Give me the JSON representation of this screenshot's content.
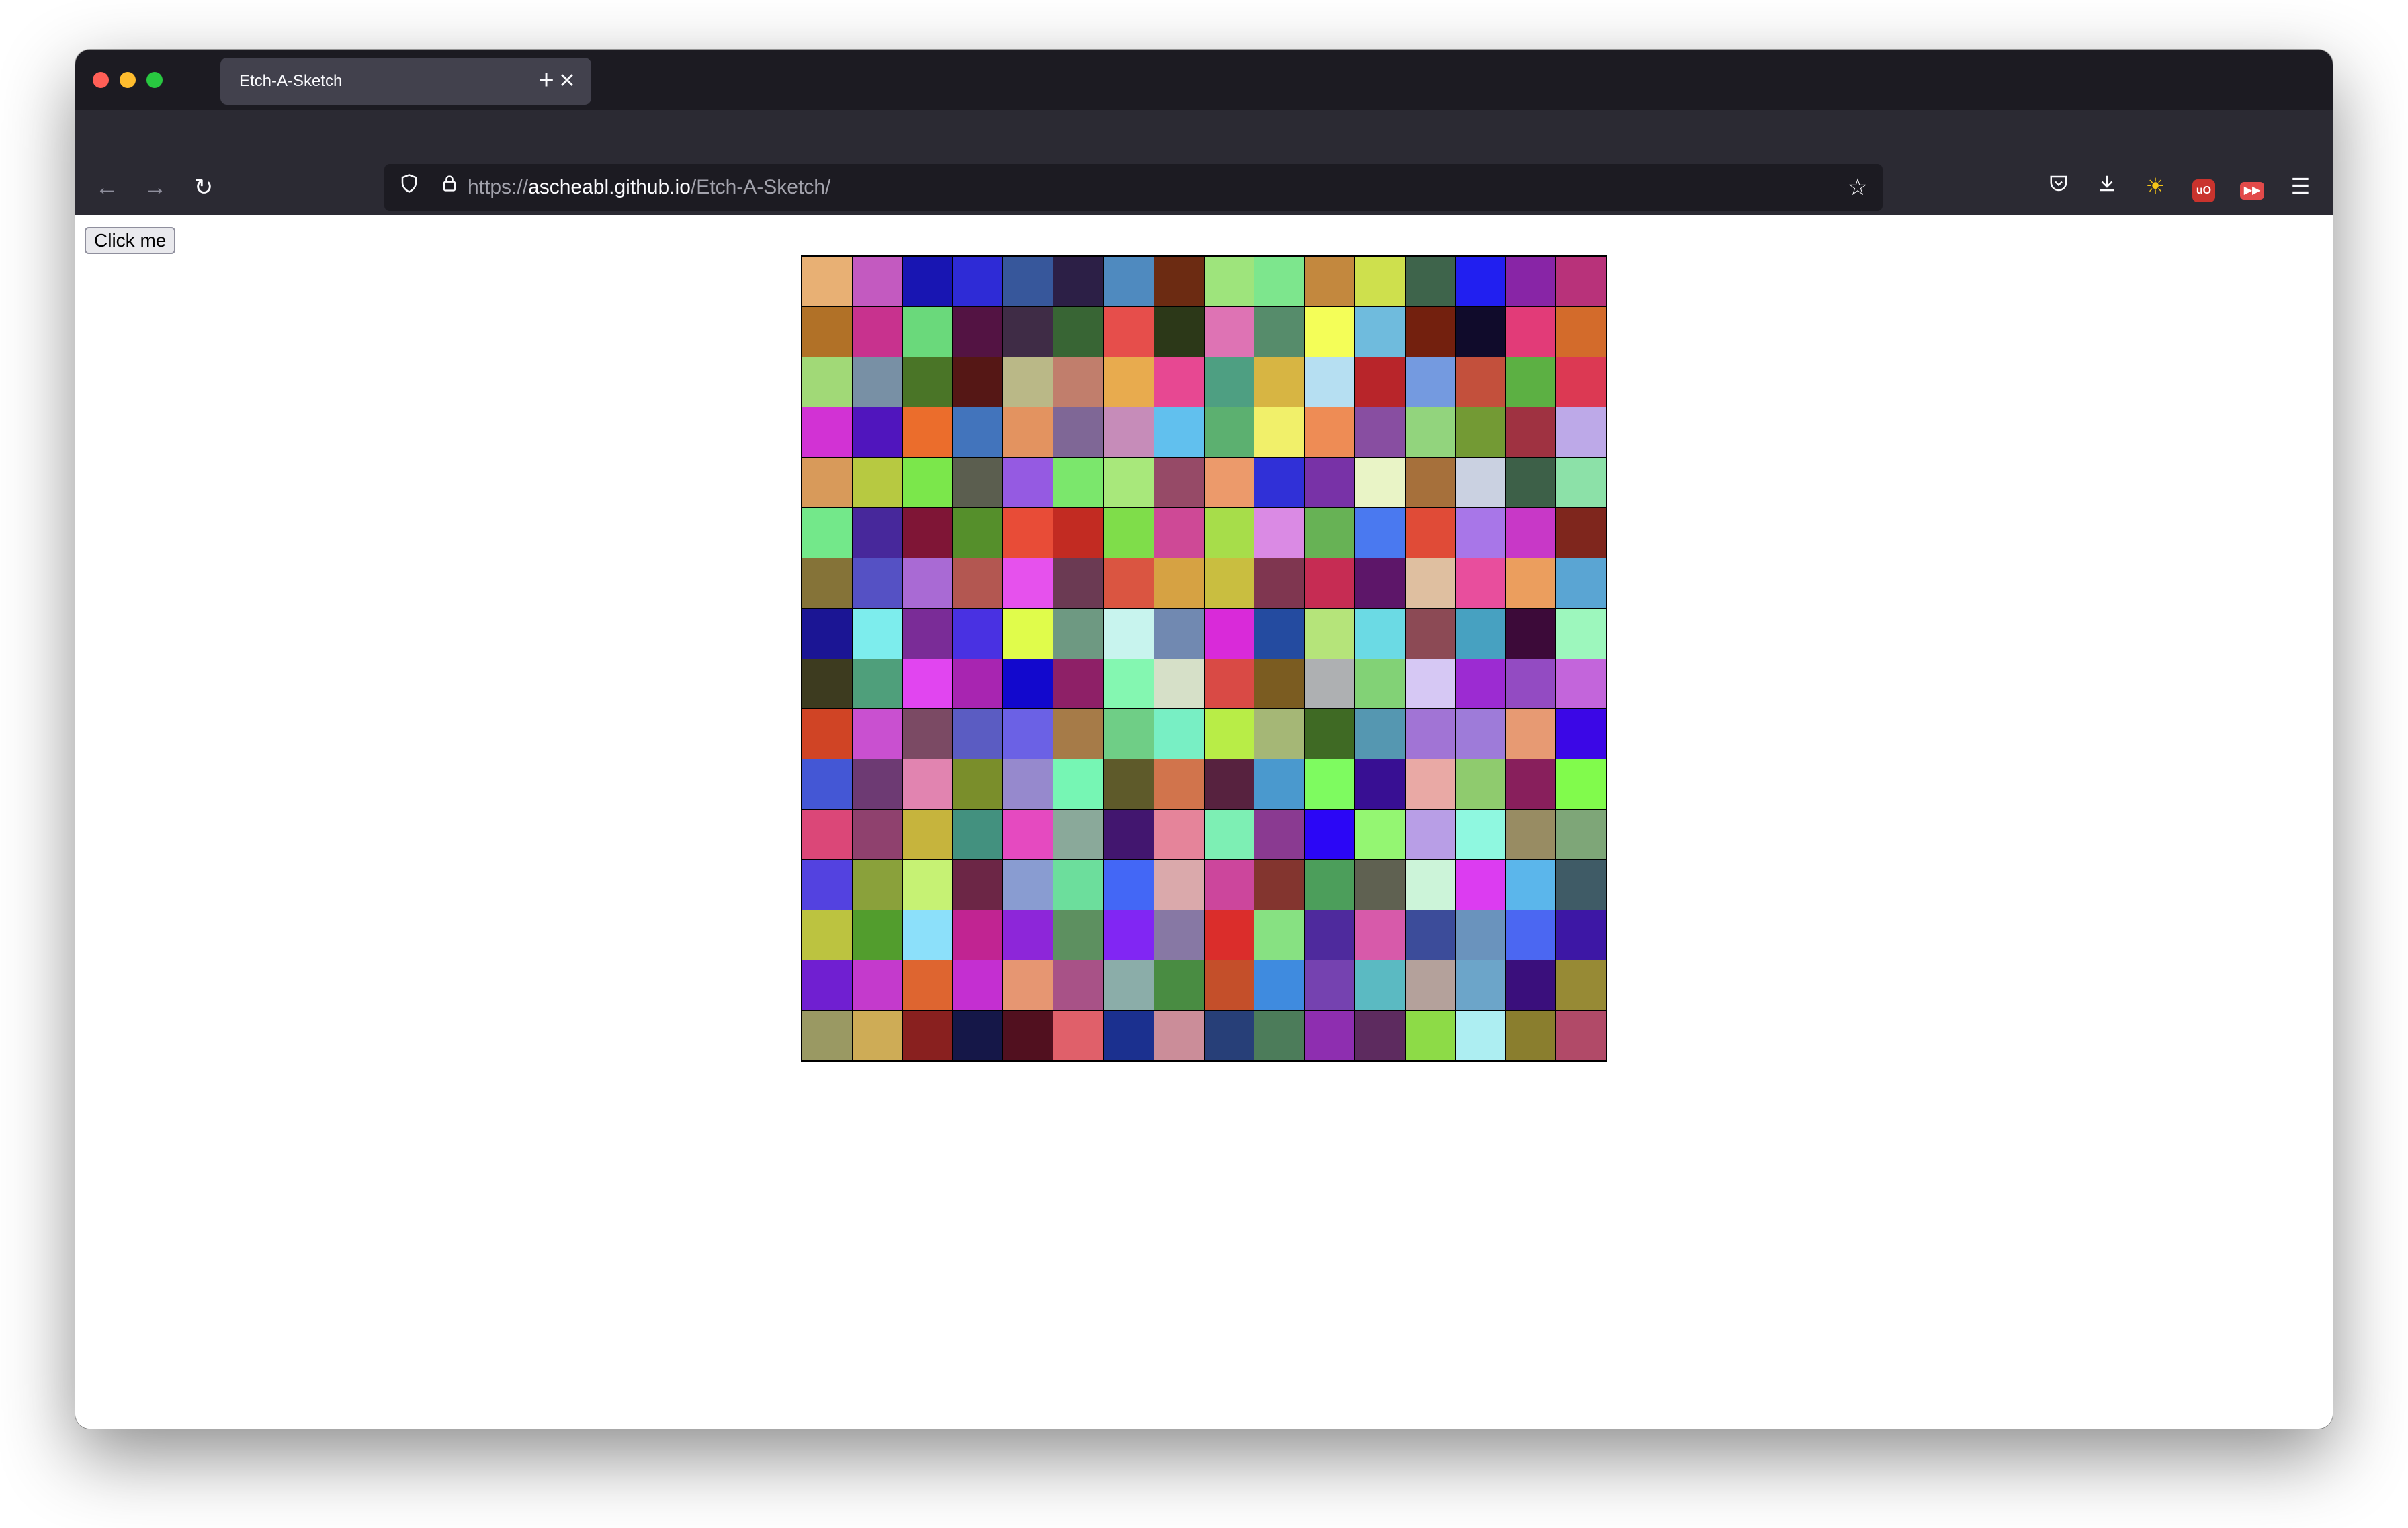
{
  "browser": {
    "tab": {
      "title": "Etch-A-Sketch",
      "close_icon": "close-icon"
    },
    "newtab_icon": "plus-icon",
    "url": {
      "scheme": "https://",
      "domain": "ascheabl.github.io",
      "path": "/Etch-A-Sketch/"
    },
    "toolbar_icons": [
      "pocket-icon",
      "download-icon",
      "sun-icon",
      "ublock-icon",
      "youtube-ext-icon",
      "menu-icon"
    ]
  },
  "page": {
    "button_label": "Click me",
    "grid": {
      "size": 16,
      "colors": [
        [
          "#e8b074",
          "#c35ac0",
          "#1815b2",
          "#2e2bd6",
          "#37579b",
          "#2c1f46",
          "#4f8abf",
          "#6c2b12",
          "#9ee47c",
          "#7de68d",
          "#c3883e",
          "#cee04d",
          "#3e644b",
          "#211ff0",
          "#8825a6",
          "#b8327a"
        ],
        [
          "#b17127",
          "#c8328e",
          "#6ad97b",
          "#531343",
          "#3f2c46",
          "#386534",
          "#e64e4b",
          "#2c3818",
          "#de73b4",
          "#568c6b",
          "#f4fe58",
          "#6fbbdd",
          "#73200e",
          "#100b2b",
          "#e23b78",
          "#d36b2b"
        ],
        [
          "#a1d977",
          "#7890a5",
          "#4a7527",
          "#551715",
          "#bab887",
          "#c17e6c",
          "#e8ab4e",
          "#e74892",
          "#4e9f82",
          "#d7b543",
          "#b6dff2",
          "#b8252a",
          "#749ae0",
          "#c3503c",
          "#5cb043",
          "#dc3953"
        ],
        [
          "#d232d4",
          "#5015bd",
          "#eb6d2c",
          "#4274bc",
          "#e39360",
          "#7f6796",
          "#c68cb9",
          "#61c0ee",
          "#5cb070",
          "#f1f06a",
          "#ee8c55",
          "#884ea1",
          "#92d47d",
          "#739a34",
          "#9f3241",
          "#bda9e8"
        ],
        [
          "#d89a5a",
          "#b7c941",
          "#7be74b",
          "#5b5e4f",
          "#955ae2",
          "#7be76c",
          "#a8e87b",
          "#964a67",
          "#ec9a6b",
          "#3030d7",
          "#7832a7",
          "#e9f4c6",
          "#a6703b",
          "#cad1e1",
          "#3d6048",
          "#8ce1a8"
        ],
        [
          "#73e88a",
          "#47289b",
          "#7f1536",
          "#558f2b",
          "#e84c37",
          "#c22b22",
          "#7fdd4a",
          "#ce4996",
          "#a7dd4a",
          "#da8ae4",
          "#67b255",
          "#4a79f0",
          "#e04b37",
          "#a876e8",
          "#c838c7",
          "#7f261d"
        ],
        [
          "#857338",
          "#5551c4",
          "#a96ad4",
          "#b35751",
          "#e651ed",
          "#6b3a53",
          "#da5541",
          "#d6a243",
          "#c9be40",
          "#7f3650",
          "#c62c53",
          "#5d1669",
          "#dfbfa0",
          "#e84e9d",
          "#eb9e5e",
          "#5aa5d3"
        ],
        [
          "#1b1594",
          "#7deded",
          "#7a2c97",
          "#4931e2",
          "#e0fc4b",
          "#6e9982",
          "#c8f4ee",
          "#7189b1",
          "#d92ad9",
          "#244ba0",
          "#b5e47a",
          "#6bdae4",
          "#8c4a55",
          "#47a1c1",
          "#3c0a39",
          "#9df7bd"
        ],
        [
          "#3d3b1f",
          "#4f9f7b",
          "#e145f0",
          "#a825b1",
          "#1208cd",
          "#8e2067",
          "#84f7b1",
          "#d6e0c8",
          "#d94a45",
          "#7b5c21",
          "#aeb0b2",
          "#82d276",
          "#d6c8f4",
          "#9c2bd2",
          "#934bc2",
          "#c365db"
        ],
        [
          "#d04425",
          "#c950d0",
          "#7b4a64",
          "#5b5cc2",
          "#6b61e5",
          "#a67b48",
          "#6fce86",
          "#78efc4",
          "#b8ed47",
          "#a5b776",
          "#3f6a24",
          "#5597b1",
          "#a174d5",
          "#9e7bd9",
          "#e79a73",
          "#3b07e6"
        ],
        [
          "#4457d5",
          "#6d3a73",
          "#e184b0",
          "#7a8e2b",
          "#9689cd",
          "#76f6b4",
          "#5e5a2a",
          "#d1744c",
          "#57223f",
          "#4a99ce",
          "#7efb60",
          "#380f93",
          "#e9a9a5",
          "#8fcb6e",
          "#881f5c",
          "#81fb4c"
        ],
        [
          "#db4778",
          "#8f416e",
          "#c6b43d",
          "#43917f",
          "#e54ac0",
          "#8aa99a",
          "#42166f",
          "#e5849a",
          "#7defb4",
          "#8a3a91",
          "#2b06f6",
          "#94f672",
          "#b89ee6",
          "#8ff8e0",
          "#988c63",
          "#7ea678"
        ],
        [
          "#5342e0",
          "#8aa13b",
          "#c6f274",
          "#6c2646",
          "#899cd1",
          "#6cde9c",
          "#4367f6",
          "#daa9ab",
          "#cc469c",
          "#83352f",
          "#4c9e5b",
          "#5f6151",
          "#ccf4d9",
          "#dc3cf1",
          "#5bb6eb",
          "#3f5b66"
        ],
        [
          "#bcc340",
          "#529d2d",
          "#8ce0fa",
          "#c12492",
          "#8d26d9",
          "#5d9060",
          "#8126f3",
          "#8778a4",
          "#db2d2b",
          "#87e182",
          "#4e2a9d",
          "#d75aaa",
          "#3c4c9a",
          "#6a93bd",
          "#4b67f2",
          "#3d17a5"
        ],
        [
          "#701fd1",
          "#c43acc",
          "#de6530",
          "#c42fd1",
          "#e69672",
          "#a85287",
          "#8bada9",
          "#498c42",
          "#c44f2a",
          "#3f8bdf",
          "#7542b0",
          "#5bbac2",
          "#b4a19b",
          "#6ca5c9",
          "#3a0f7c",
          "#978a35"
        ],
        [
          "#9a9963",
          "#ceac56",
          "#89201f",
          "#151748",
          "#51101f",
          "#e0606a",
          "#1b308f",
          "#cb8d99",
          "#273f78",
          "#4c7c5a",
          "#8e2eb0",
          "#5d2b5f",
          "#8ddb47",
          "#adeef2",
          "#8a7e2e",
          "#b14a68"
        ]
      ]
    }
  }
}
